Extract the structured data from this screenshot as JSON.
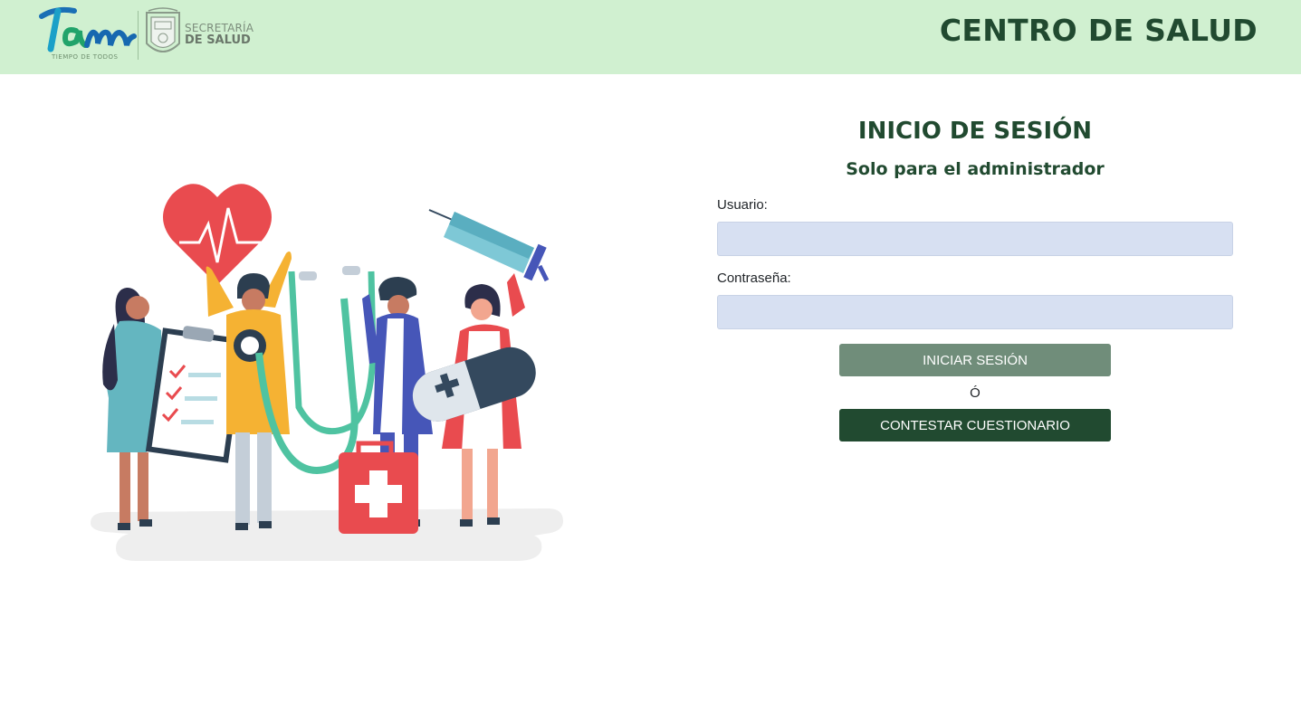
{
  "header": {
    "brand_title": "CENTRO DE SALUD",
    "logo": {
      "tam_text": "Tam",
      "tagline": "TIEMPO DE TODOS",
      "secretaria_line1": "SECRETARÍA",
      "secretaria_line2": "DE SALUD"
    }
  },
  "login": {
    "title": "INICIO DE SESIÓN",
    "subtitle": "Solo para el administrador",
    "username_label": "Usuario:",
    "username_value": "",
    "password_label": "Contraseña:",
    "password_value": "",
    "login_button": "INICIAR SESIÓN",
    "or_text": "Ó",
    "quiz_button": "CONTESTAR CUESTIONARIO"
  },
  "colors": {
    "header_bg": "#d0f0d0",
    "primary_dark": "#214a30",
    "button_muted": "#708d7a",
    "input_bg": "#d7e0f2"
  }
}
